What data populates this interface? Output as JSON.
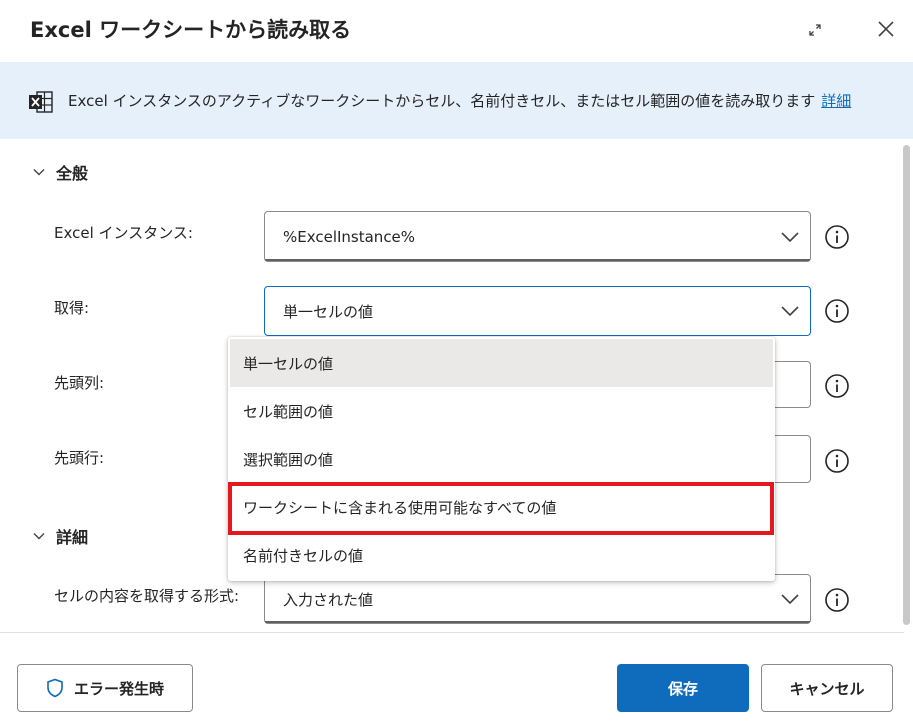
{
  "dialog": {
    "title": "Excel ワークシートから読み取る"
  },
  "banner": {
    "description": "Excel インスタンスのアクティブなワークシートからセル、名前付きセル、またはセル範囲の値を読み取ります",
    "link": "詳細"
  },
  "sections": {
    "general": {
      "label": "全般"
    },
    "advanced": {
      "label": "詳細"
    }
  },
  "fields": {
    "excel_instance": {
      "label": "Excel インスタンス:",
      "value": "%ExcelInstance%"
    },
    "retrieve": {
      "label": "取得:",
      "value": "単一セルの値"
    },
    "start_column": {
      "label": "先頭列:"
    },
    "start_row": {
      "label": "先頭行:"
    },
    "cell_format": {
      "label": "セルの内容を取得する形式:",
      "value": "入力された値"
    }
  },
  "dropdown": {
    "options": [
      "単一セルの値",
      "セル範囲の値",
      "選択範囲の値",
      "ワークシートに含まれる使用可能なすべての値",
      "名前付きセルの値"
    ],
    "selected_index": 0,
    "highlighted_index": 3
  },
  "footer": {
    "on_error": "エラー発生時",
    "save": "保存",
    "cancel": "キャンセル"
  },
  "colors": {
    "accent": "#0f6cbd",
    "banner_bg": "#e6f0fb",
    "highlight": "#e3191f",
    "excel_icon": "#242424"
  }
}
